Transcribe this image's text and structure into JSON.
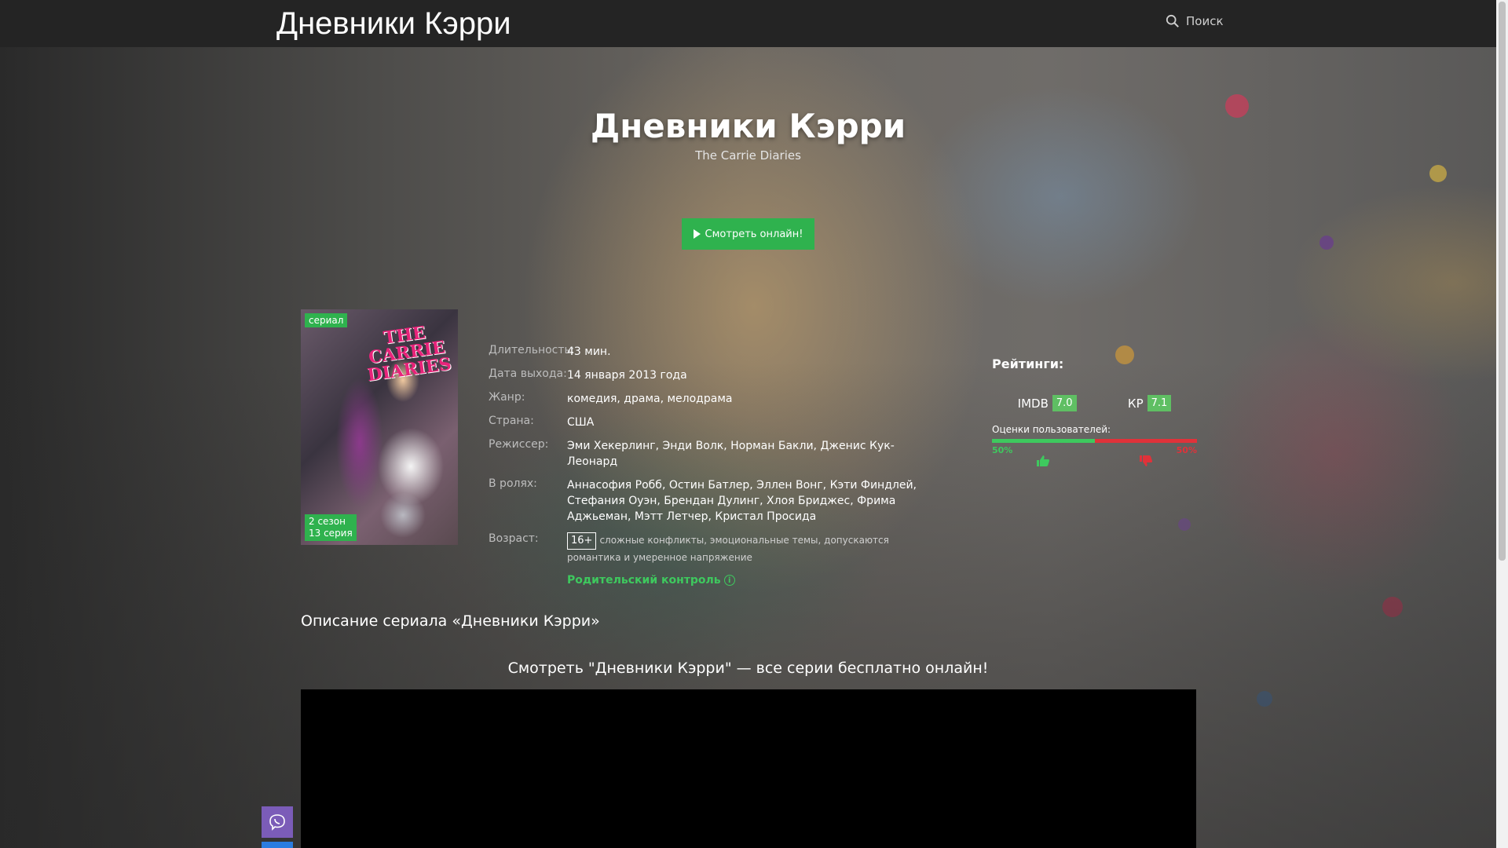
{
  "header": {
    "site_title": "Дневники Кэрри",
    "search_label": "Поиск"
  },
  "hero": {
    "title": "Дневники Кэрри",
    "original_title": "The Carrie Diaries",
    "watch_button": "Смотреть онлайн!"
  },
  "poster": {
    "logo_text": "THE CARRIE DIARIES",
    "type_badge": "сериал",
    "season": "2 сезон",
    "episode": "13 серия"
  },
  "info": {
    "duration": {
      "label": "Длительность:",
      "value": "43 мин."
    },
    "release": {
      "label": "Дата выхода:",
      "value": "14 января 2013 года"
    },
    "genre": {
      "label": "Жанр:",
      "value": "комедия, драма, мелодрама"
    },
    "country": {
      "label": "Страна:",
      "value": "США"
    },
    "director": {
      "label": "Режиссер:",
      "value": "Эми Хекерлинг, Энди Волк, Норман Бакли, Дженис Кук-Леонард"
    },
    "cast": {
      "label": "В ролях:",
      "value": "Аннасофия Робб, Остин Батлер, Эллен Вонг, Кэти Финдлей, Стефания Оуэн, Брендан Дулинг, Хлоя Бриджес, Фрима Аджьеман, Мэтт Летчер, Кристал Просида"
    },
    "age": {
      "label": "Возраст:",
      "badge": "16+",
      "desc": "сложные конфликты, эмоциональные темы, допускаются романтика и умеренное напряжение"
    },
    "parental_control": "Родительский контроль"
  },
  "ratings": {
    "title": "Рейтинги:",
    "imdb_label": "IMDB",
    "imdb_score": "7.0",
    "kp_label": "КР",
    "kp_score": "7.1",
    "user_title": "Оценки пользователей:",
    "like_pct": "50%",
    "dislike_pct": "50%",
    "like_fraction": 0.5,
    "colors": {
      "like": "#3ec95e",
      "dislike": "#e0323a"
    }
  },
  "description_heading": "Описание сериала «Дневники Кэрри»",
  "watch_heading": "Смотреть \"Дневники Кэрри\" — все серии бесплатно онлайн!",
  "accent_color": "#2fb24e"
}
